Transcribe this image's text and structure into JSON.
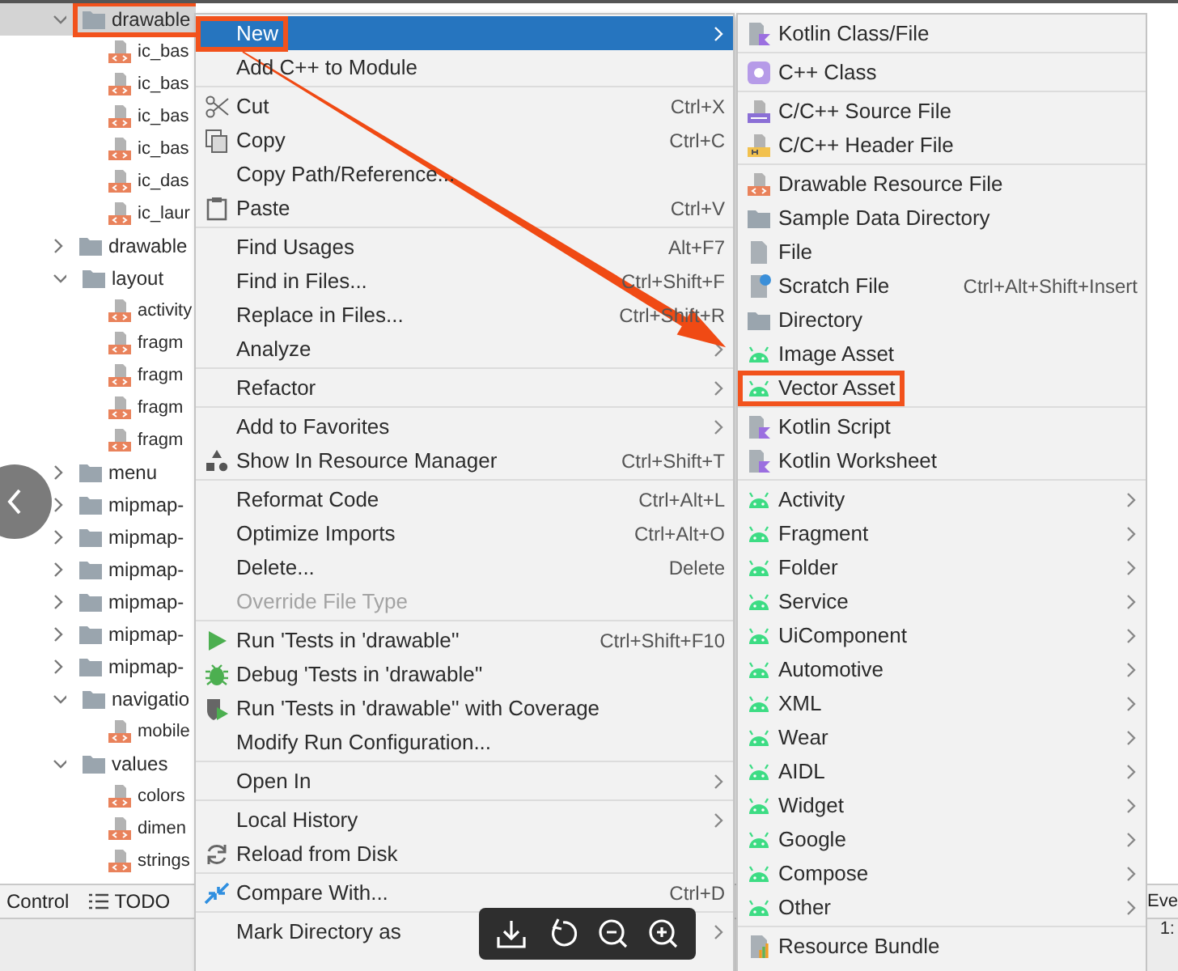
{
  "project_tree": [
    {
      "label": "drawable",
      "kind": "folder",
      "expanded": true,
      "selected": true,
      "marked": true,
      "children": [
        {
          "label": "ic_bas",
          "kind": "xml-file",
          "selected": false,
          "marked": false
        },
        {
          "label": "ic_bas",
          "kind": "xml-file",
          "selected": false,
          "marked": false
        },
        {
          "label": "ic_bas",
          "kind": "xml-file",
          "selected": false,
          "marked": false
        },
        {
          "label": "ic_bas",
          "kind": "xml-file",
          "selected": false,
          "marked": false
        },
        {
          "label": "ic_das",
          "kind": "xml-file",
          "selected": false,
          "marked": false
        },
        {
          "label": "ic_laur",
          "kind": "xml-file",
          "selected": false,
          "marked": false
        }
      ]
    },
    {
      "label": "drawable",
      "kind": "folder",
      "expanded": false,
      "selected": false,
      "marked": false
    },
    {
      "label": "layout",
      "kind": "folder",
      "expanded": true,
      "selected": false,
      "marked": false,
      "children": [
        {
          "label": "activity",
          "kind": "xml-file",
          "selected": false,
          "marked": false
        },
        {
          "label": "fragm",
          "kind": "xml-file",
          "selected": false,
          "marked": false
        },
        {
          "label": "fragm",
          "kind": "xml-file",
          "selected": false,
          "marked": false
        },
        {
          "label": "fragm",
          "kind": "xml-file",
          "selected": false,
          "marked": false
        },
        {
          "label": "fragm",
          "kind": "xml-file",
          "selected": false,
          "marked": false
        }
      ]
    },
    {
      "label": "menu",
      "kind": "folder",
      "expanded": false,
      "selected": false,
      "marked": false
    },
    {
      "label": "mipmap-",
      "kind": "folder",
      "expanded": false,
      "selected": false,
      "marked": false
    },
    {
      "label": "mipmap-",
      "kind": "folder",
      "expanded": false,
      "selected": false,
      "marked": false
    },
    {
      "label": "mipmap-",
      "kind": "folder",
      "expanded": false,
      "selected": false,
      "marked": false
    },
    {
      "label": "mipmap-",
      "kind": "folder",
      "expanded": false,
      "selected": false,
      "marked": false
    },
    {
      "label": "mipmap-",
      "kind": "folder",
      "expanded": false,
      "selected": false,
      "marked": false
    },
    {
      "label": "mipmap-",
      "kind": "folder",
      "expanded": false,
      "selected": false,
      "marked": false
    },
    {
      "label": "navigatio",
      "kind": "folder",
      "expanded": true,
      "selected": false,
      "marked": false,
      "children": [
        {
          "label": "mobile",
          "kind": "xml-file",
          "selected": false,
          "marked": false
        }
      ]
    },
    {
      "label": "values",
      "kind": "folder",
      "expanded": true,
      "selected": false,
      "marked": false,
      "children": [
        {
          "label": "colors",
          "kind": "xml-file",
          "selected": false,
          "marked": false
        },
        {
          "label": "dimen",
          "kind": "xml-file",
          "selected": false,
          "marked": false
        },
        {
          "label": "strings",
          "kind": "xml-file",
          "selected": false,
          "marked": false
        }
      ]
    }
  ],
  "tool_strip": {
    "tabs": [
      {
        "label": "Control",
        "kind": "plain"
      },
      {
        "label": "TODO",
        "kind": "list"
      }
    ],
    "right_tab": "Eve"
  },
  "status_bar": {
    "text": "1:"
  },
  "context_menu": {
    "groups": [
      [
        {
          "label": "New",
          "kind": "plain",
          "submenu": true,
          "selected": true,
          "disabled": false,
          "marked": true
        },
        {
          "label": "Add C++ to Module",
          "kind": "plain",
          "submenu": false,
          "selected": false,
          "disabled": false,
          "marked": false
        }
      ],
      [
        {
          "label": "Cut",
          "shortcut": "Ctrl+X",
          "kind": "scissors",
          "submenu": false,
          "selected": false,
          "disabled": false,
          "marked": false
        },
        {
          "label": "Copy",
          "shortcut": "Ctrl+C",
          "kind": "copy",
          "submenu": false,
          "selected": false,
          "disabled": false,
          "marked": false
        },
        {
          "label": "Copy Path/Reference...",
          "kind": "plain",
          "submenu": false,
          "selected": false,
          "disabled": false,
          "marked": false
        },
        {
          "label": "Paste",
          "shortcut": "Ctrl+V",
          "kind": "clipboard",
          "submenu": false,
          "selected": false,
          "disabled": false,
          "marked": false
        }
      ],
      [
        {
          "label": "Find Usages",
          "shortcut": "Alt+F7",
          "kind": "plain",
          "submenu": false,
          "selected": false,
          "disabled": false,
          "marked": false
        },
        {
          "label": "Find in Files...",
          "shortcut": "Ctrl+Shift+F",
          "kind": "plain",
          "submenu": false,
          "selected": false,
          "disabled": false,
          "marked": false
        },
        {
          "label": "Replace in Files...",
          "shortcut": "Ctrl+Shift+R",
          "kind": "plain",
          "submenu": false,
          "selected": false,
          "disabled": false,
          "marked": false
        },
        {
          "label": "Analyze",
          "kind": "plain",
          "submenu": true,
          "selected": false,
          "disabled": false,
          "marked": false
        }
      ],
      [
        {
          "label": "Refactor",
          "kind": "plain",
          "submenu": true,
          "selected": false,
          "disabled": false,
          "marked": false
        }
      ],
      [
        {
          "label": "Add to Favorites",
          "kind": "plain",
          "submenu": true,
          "selected": false,
          "disabled": false,
          "marked": false
        },
        {
          "label": "Show In Resource Manager",
          "shortcut": "Ctrl+Shift+T",
          "kind": "resource-manager",
          "submenu": false,
          "selected": false,
          "disabled": false,
          "marked": false
        }
      ],
      [
        {
          "label": "Reformat Code",
          "shortcut": "Ctrl+Alt+L",
          "kind": "plain",
          "submenu": false,
          "selected": false,
          "disabled": false,
          "marked": false
        },
        {
          "label": "Optimize Imports",
          "shortcut": "Ctrl+Alt+O",
          "kind": "plain",
          "submenu": false,
          "selected": false,
          "disabled": false,
          "marked": false
        },
        {
          "label": "Delete...",
          "shortcut": "Delete",
          "kind": "plain",
          "submenu": false,
          "selected": false,
          "disabled": false,
          "marked": false
        },
        {
          "label": "Override File Type",
          "kind": "plain",
          "submenu": false,
          "selected": false,
          "disabled": true,
          "marked": false
        }
      ],
      [
        {
          "label": "Run 'Tests in 'drawable''",
          "shortcut": "Ctrl+Shift+F10",
          "kind": "run",
          "submenu": false,
          "selected": false,
          "disabled": false,
          "marked": false
        },
        {
          "label": "Debug 'Tests in 'drawable''",
          "kind": "debug",
          "submenu": false,
          "selected": false,
          "disabled": false,
          "marked": false
        },
        {
          "label": "Run 'Tests in 'drawable'' with Coverage",
          "kind": "coverage",
          "submenu": false,
          "selected": false,
          "disabled": false,
          "marked": false
        },
        {
          "label": "Modify Run Configuration...",
          "kind": "plain",
          "submenu": false,
          "selected": false,
          "disabled": false,
          "marked": false
        }
      ],
      [
        {
          "label": "Open In",
          "kind": "plain",
          "submenu": true,
          "selected": false,
          "disabled": false,
          "marked": false
        }
      ],
      [
        {
          "label": "Local History",
          "kind": "plain",
          "submenu": true,
          "selected": false,
          "disabled": false,
          "marked": false
        },
        {
          "label": "Reload from Disk",
          "kind": "reload",
          "submenu": false,
          "selected": false,
          "disabled": false,
          "marked": false
        }
      ],
      [
        {
          "label": "Compare With...",
          "shortcut": "Ctrl+D",
          "kind": "compare",
          "submenu": false,
          "selected": false,
          "disabled": false,
          "marked": false
        }
      ],
      [
        {
          "label": "Mark Directory as",
          "kind": "plain",
          "submenu": true,
          "selected": false,
          "disabled": false,
          "marked": false
        }
      ]
    ]
  },
  "new_submenu": {
    "groups": [
      [
        {
          "label": "Kotlin Class/File",
          "kind": "kotlin-file",
          "submenu": false,
          "selected": false,
          "marked": false
        }
      ],
      [
        {
          "label": "C++ Class",
          "kind": "cpp-class",
          "submenu": false,
          "selected": false,
          "marked": false
        }
      ],
      [
        {
          "label": "C/C++ Source File",
          "kind": "cpp-source",
          "submenu": false,
          "selected": false,
          "marked": false
        },
        {
          "label": "C/C++ Header File",
          "kind": "cpp-header",
          "submenu": false,
          "selected": false,
          "marked": false
        }
      ],
      [
        {
          "label": "Drawable Resource File",
          "kind": "xml-file",
          "submenu": false,
          "selected": false,
          "marked": false
        },
        {
          "label": "Sample Data Directory",
          "kind": "folder",
          "submenu": false,
          "selected": false,
          "marked": false
        },
        {
          "label": "File",
          "kind": "file",
          "submenu": false,
          "selected": false,
          "marked": false
        },
        {
          "label": "Scratch File",
          "shortcut": "Ctrl+Alt+Shift+Insert",
          "kind": "scratch",
          "submenu": false,
          "selected": false,
          "marked": false
        },
        {
          "label": "Directory",
          "kind": "folder",
          "submenu": false,
          "selected": false,
          "marked": false
        },
        {
          "label": "Image Asset",
          "kind": "android",
          "submenu": false,
          "selected": false,
          "marked": false
        },
        {
          "label": "Vector Asset",
          "kind": "android",
          "submenu": false,
          "selected": false,
          "marked": true
        }
      ],
      [
        {
          "label": "Kotlin Script",
          "kind": "kotlin-file",
          "submenu": false,
          "selected": false,
          "marked": false
        },
        {
          "label": "Kotlin Worksheet",
          "kind": "kotlin-file",
          "submenu": false,
          "selected": false,
          "marked": false
        }
      ],
      [
        {
          "label": "Activity",
          "kind": "android",
          "submenu": true,
          "selected": false,
          "marked": false
        },
        {
          "label": "Fragment",
          "kind": "android",
          "submenu": true,
          "selected": false,
          "marked": false
        },
        {
          "label": "Folder",
          "kind": "android",
          "submenu": true,
          "selected": false,
          "marked": false
        },
        {
          "label": "Service",
          "kind": "android",
          "submenu": true,
          "selected": false,
          "marked": false
        },
        {
          "label": "UiComponent",
          "kind": "android",
          "submenu": true,
          "selected": false,
          "marked": false
        },
        {
          "label": "Automotive",
          "kind": "android",
          "submenu": true,
          "selected": false,
          "marked": false
        },
        {
          "label": "XML",
          "kind": "android",
          "submenu": true,
          "selected": false,
          "marked": false
        },
        {
          "label": "Wear",
          "kind": "android",
          "submenu": true,
          "selected": false,
          "marked": false
        },
        {
          "label": "AIDL",
          "kind": "android",
          "submenu": true,
          "selected": false,
          "marked": false
        },
        {
          "label": "Widget",
          "kind": "android",
          "submenu": true,
          "selected": false,
          "marked": false
        },
        {
          "label": "Google",
          "kind": "android",
          "submenu": true,
          "selected": false,
          "marked": false
        },
        {
          "label": "Compose",
          "kind": "android",
          "submenu": true,
          "selected": false,
          "marked": false
        },
        {
          "label": "Other",
          "kind": "android",
          "submenu": true,
          "selected": false,
          "marked": false
        }
      ],
      [
        {
          "label": "Resource Bundle",
          "kind": "resource-bundle",
          "submenu": false,
          "selected": false,
          "marked": false
        }
      ]
    ]
  }
}
